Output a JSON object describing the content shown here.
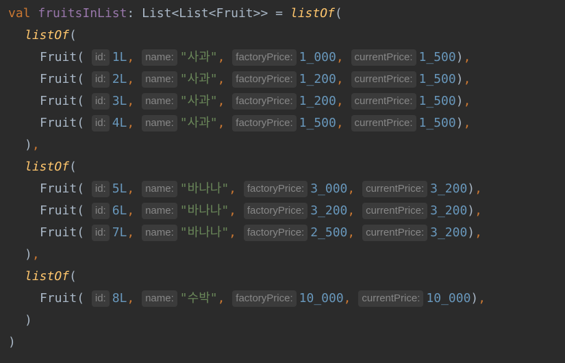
{
  "code": {
    "decl_keyword": "val",
    "decl_name": "fruitsInList",
    "decl_colon": ":",
    "decl_type": "List<List<Fruit>>",
    "decl_eq": "=",
    "list_of": "listOf",
    "open_paren": "(",
    "close_paren": ")",
    "comma": ",",
    "fruit_ctor": "Fruit",
    "hints": {
      "id": "id:",
      "name": "name:",
      "factoryPrice": "factoryPrice:",
      "currentPrice": "currentPrice:"
    },
    "groups": [
      {
        "rows": [
          {
            "id": "1L",
            "name": "\"사과\"",
            "factoryPrice": "1_000",
            "currentPrice": "1_500"
          },
          {
            "id": "2L",
            "name": "\"사과\"",
            "factoryPrice": "1_200",
            "currentPrice": "1_500"
          },
          {
            "id": "3L",
            "name": "\"사과\"",
            "factoryPrice": "1_200",
            "currentPrice": "1_500"
          },
          {
            "id": "4L",
            "name": "\"사과\"",
            "factoryPrice": "1_500",
            "currentPrice": "1_500"
          }
        ]
      },
      {
        "rows": [
          {
            "id": "5L",
            "name": "\"바나나\"",
            "factoryPrice": "3_000",
            "currentPrice": "3_200"
          },
          {
            "id": "6L",
            "name": "\"바나나\"",
            "factoryPrice": "3_200",
            "currentPrice": "3_200"
          },
          {
            "id": "7L",
            "name": "\"바나나\"",
            "factoryPrice": "2_500",
            "currentPrice": "3_200"
          }
        ]
      },
      {
        "rows": [
          {
            "id": "8L",
            "name": "\"수박\"",
            "factoryPrice": "10_000",
            "currentPrice": "10_000"
          }
        ]
      }
    ]
  },
  "colors": {
    "background": "#2b2b2b",
    "keyword": "#cc7832",
    "property": "#9876aa",
    "number": "#6897bb",
    "string": "#6a8759",
    "function_italic": "#ffc66d",
    "hint_text": "#878787",
    "hint_bg": "#3b3b3b"
  }
}
